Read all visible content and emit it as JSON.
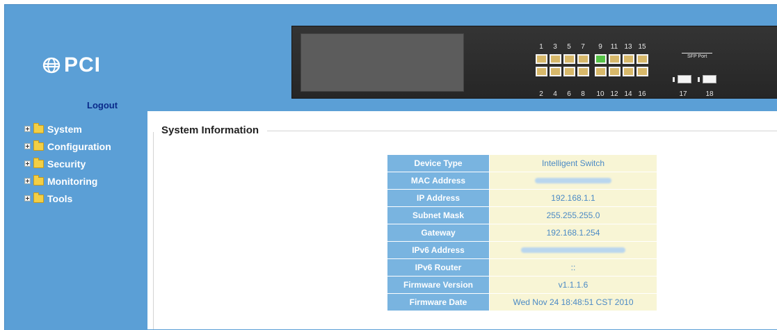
{
  "brand": {
    "logo_text": "PCI"
  },
  "header": {
    "logout_label": "Logout"
  },
  "sidebar": {
    "items": [
      {
        "label": "System"
      },
      {
        "label": "Configuration"
      },
      {
        "label": "Security"
      },
      {
        "label": "Monitoring"
      },
      {
        "label": "Tools"
      }
    ]
  },
  "device_panel": {
    "top_port_numbers": [
      "1",
      "3",
      "5",
      "7",
      "9",
      "11",
      "13",
      "15"
    ],
    "bottom_port_numbers": [
      "2",
      "4",
      "6",
      "8",
      "10",
      "12",
      "14",
      "16"
    ],
    "sfp_label": "SFP Port",
    "sfp_port_numbers": [
      "17",
      "18"
    ],
    "active_port": "9"
  },
  "main": {
    "section_title": "System Information",
    "info_rows": [
      {
        "label": "Device Type",
        "value": "Intelligent Switch"
      },
      {
        "label": "MAC Address",
        "value": ""
      },
      {
        "label": "IP Address",
        "value": "192.168.1.1"
      },
      {
        "label": "Subnet Mask",
        "value": "255.255.255.0"
      },
      {
        "label": "Gateway",
        "value": "192.168.1.254"
      },
      {
        "label": "IPv6 Address",
        "value": ""
      },
      {
        "label": "IPv6 Router",
        "value": "::"
      },
      {
        "label": "Firmware Version",
        "value": "v1.1.1.6"
      },
      {
        "label": "Firmware Date",
        "value": "Wed Nov 24 18:48:51 CST 2010"
      }
    ]
  },
  "colors": {
    "frame_blue": "#5b9fd6",
    "label_cell": "#79b4e0",
    "value_cell": "#f8f5d5",
    "value_text": "#4b8ac5",
    "active_port": "#56c247",
    "logout_text": "#0a2a8a"
  }
}
